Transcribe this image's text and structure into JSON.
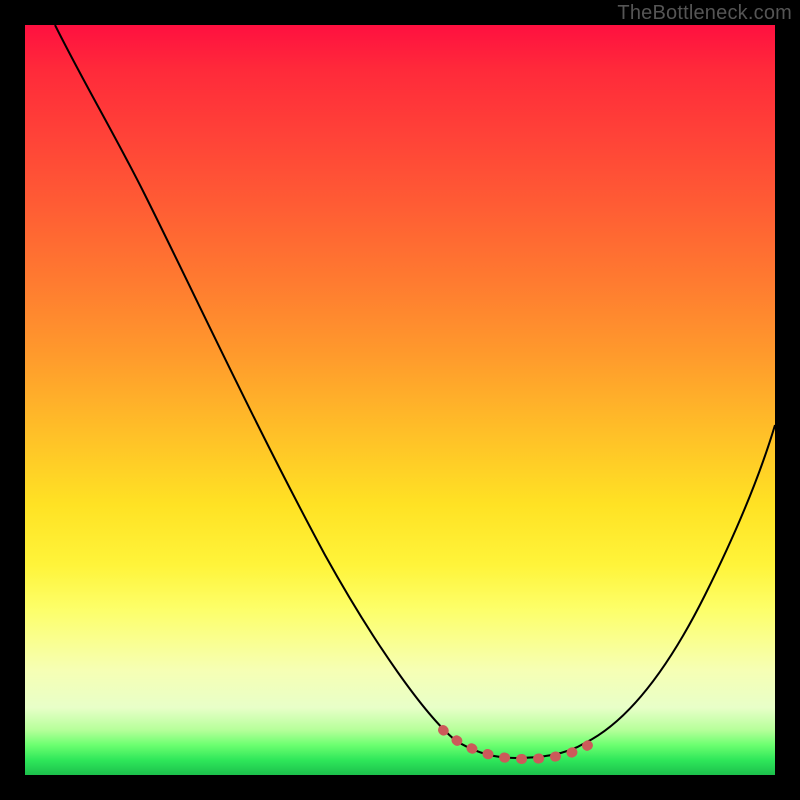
{
  "attribution": "TheBottleneck.com",
  "chart_data": {
    "type": "line",
    "title": "",
    "xlabel": "",
    "ylabel": "",
    "xlim": [
      0,
      100
    ],
    "ylim": [
      0,
      100
    ],
    "series": [
      {
        "name": "bottleneck-curve",
        "x": [
          4,
          10,
          20,
          30,
          40,
          48,
          54,
          58,
          62,
          66,
          70,
          75,
          80,
          86,
          92,
          98,
          100
        ],
        "values": [
          100,
          90,
          74,
          58,
          42,
          28,
          15,
          7,
          3,
          2,
          2,
          3,
          6,
          14,
          26,
          42,
          48
        ]
      }
    ],
    "annotations": [
      {
        "name": "optimal-range-dots",
        "x_start": 55,
        "x_end": 76,
        "y": 3
      }
    ],
    "background_gradient": {
      "top": "#ff1040",
      "mid": "#ffe224",
      "bottom": "#1cc04c"
    }
  }
}
